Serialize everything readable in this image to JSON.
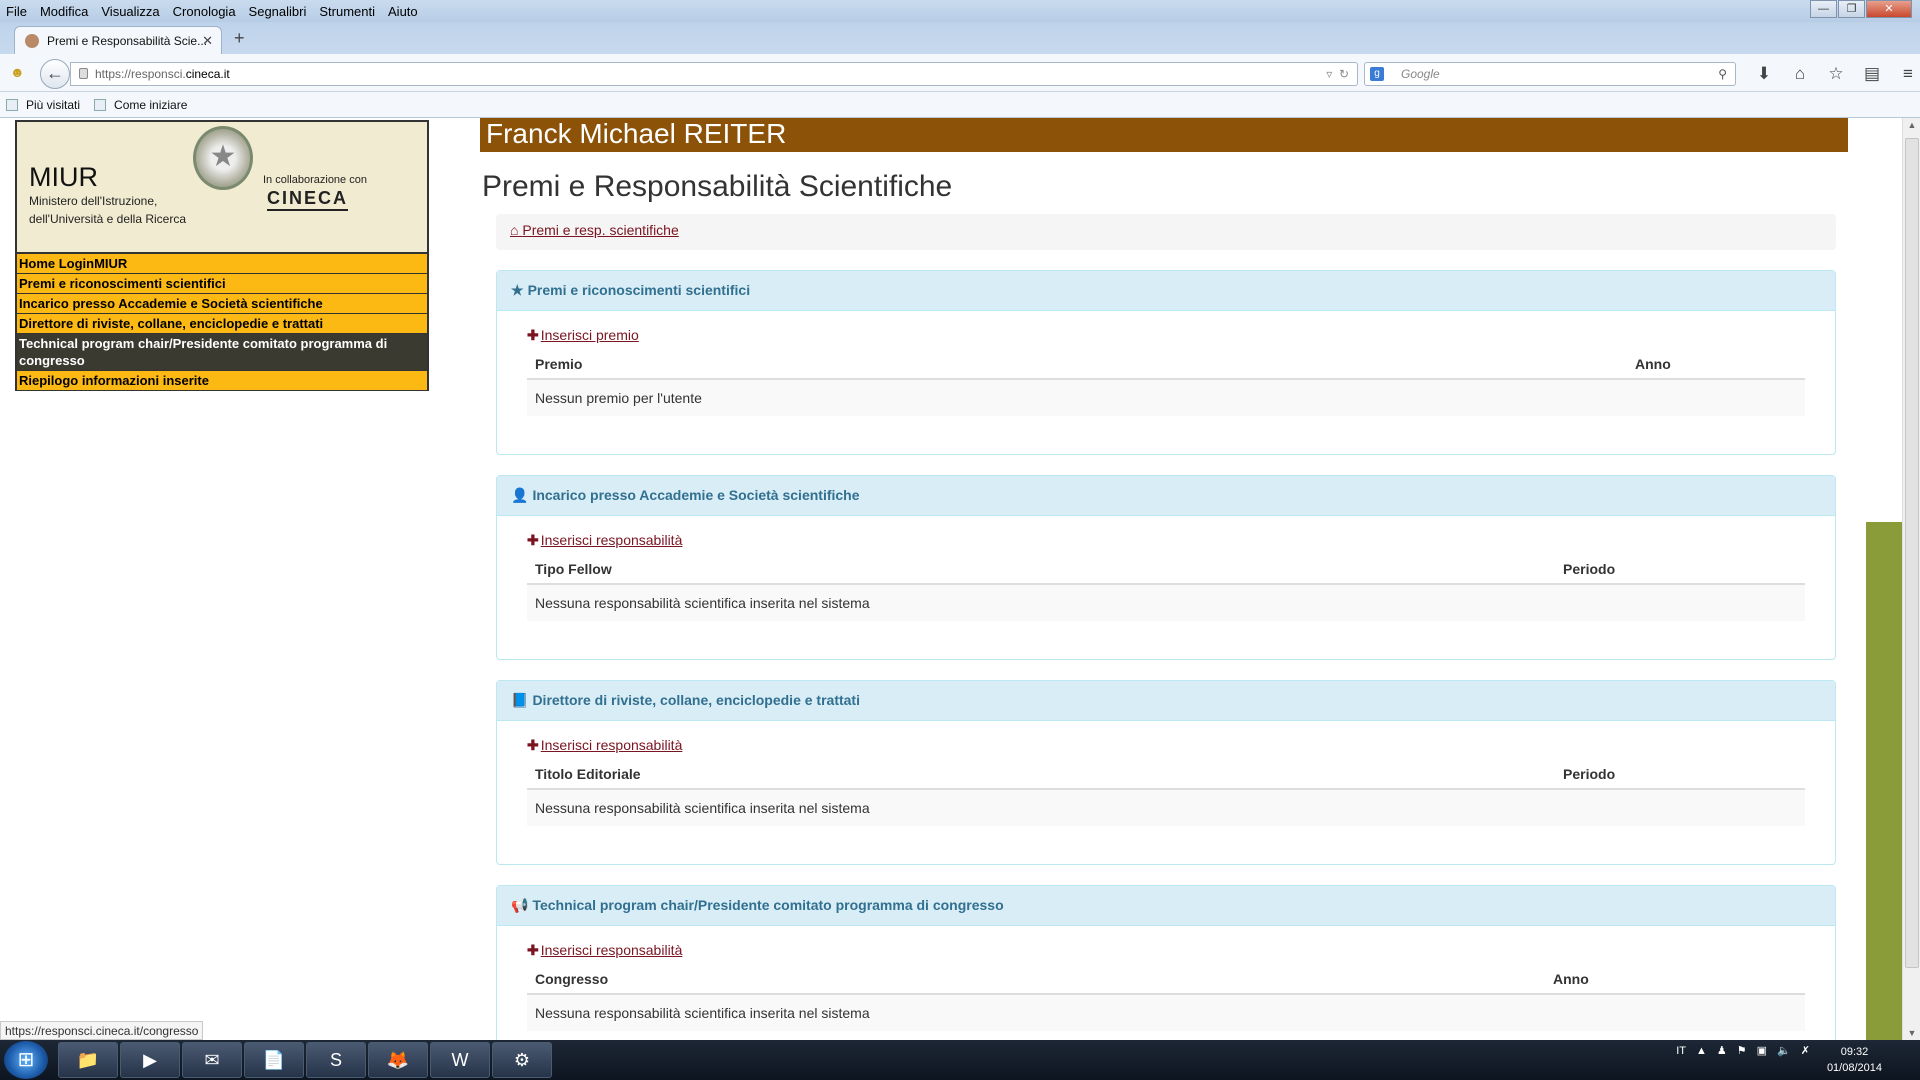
{
  "browser": {
    "menu": [
      "File",
      "Modifica",
      "Visualizza",
      "Cronologia",
      "Segnalibri",
      "Strumenti",
      "Aiuto"
    ],
    "tab_title": "Premi e Responsabilità Scie...",
    "url_prefix": "https://responsci.",
    "url_domain": "cineca.it",
    "search_placeholder": "Google",
    "bookmarks": [
      "Più visitati",
      "Come iniziare"
    ],
    "status_url": "https://responsci.cineca.it/congresso"
  },
  "sidebar": {
    "logo_title": "MIUR",
    "logo_subtitle": "Ministero dell'Istruzione, dell'Università e della Ricerca",
    "collab_text": "In collaborazione con",
    "collab_brand": "CINECA",
    "menu": [
      "Home LoginMIUR",
      "Premi e riconoscimenti scientifici",
      "Incarico presso Accademie e Società scientifiche",
      "Direttore di riviste, collane, enciclopedie e trattati",
      "Technical program chair/Presidente comitato programma di congresso",
      "Riepilogo informazioni inserite"
    ]
  },
  "main": {
    "user_name": "Franck Michael REITER",
    "page_title": "Premi e Responsabilità Scientifiche",
    "breadcrumb": "Premi e resp. scientifiche",
    "panels": [
      {
        "icon": "★",
        "title": "Premi e riconoscimenti scientifici",
        "add": "Inserisci premio",
        "col1": "Premio",
        "col2": "Anno",
        "empty": "Nessun premio per l'utente"
      },
      {
        "icon": "👤",
        "title": "Incarico presso Accademie e Società scientifiche",
        "add": "Inserisci responsabilità",
        "col1": "Tipo Fellow",
        "col2": "Periodo",
        "empty": "Nessuna responsabilità scientifica inserita nel sistema"
      },
      {
        "icon": "📘",
        "title": "Direttore di riviste, collane, enciclopedie e trattati",
        "add": "Inserisci responsabilità",
        "col1": "Titolo Editoriale",
        "col2": "Periodo",
        "empty": "Nessuna responsabilità scientifica inserita nel sistema"
      },
      {
        "icon": "📢",
        "title": "Technical program chair/Presidente comitato programma di congresso",
        "add": "Inserisci responsabilità",
        "col1": "Congresso",
        "col2": "Anno",
        "empty": "Nessuna responsabilità scientifica inserita nel sistema"
      }
    ]
  },
  "taskbar": {
    "lang": "IT",
    "time": "09:32",
    "date": "01/08/2014"
  }
}
